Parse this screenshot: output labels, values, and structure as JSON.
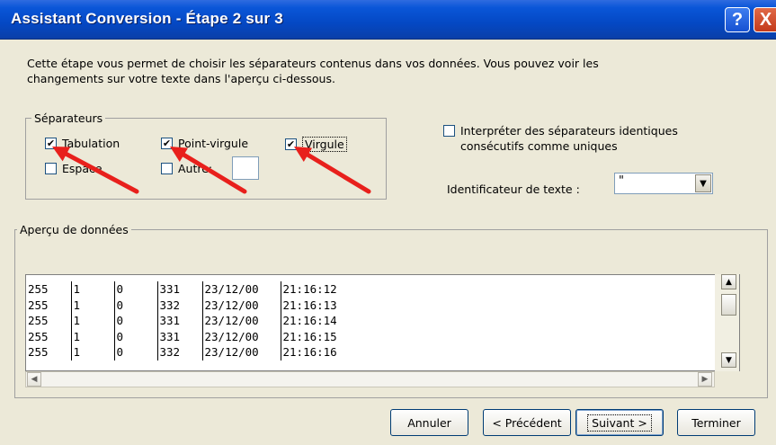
{
  "window": {
    "title": "Assistant Conversion - Étape 2 sur 3",
    "help_label": "?",
    "close_label": "X"
  },
  "description": {
    "line1": "Cette étape vous permet de choisir les séparateurs contenus dans vos données. Vous pouvez voir les",
    "line2": "changements sur votre texte dans l'aperçu ci-dessous."
  },
  "separators": {
    "legend": "Séparateurs",
    "tab": {
      "label": "Tabulation",
      "checked": true
    },
    "semicolon": {
      "label": "Point-virgule",
      "checked": true
    },
    "comma": {
      "label": "Virgule",
      "checked": true
    },
    "space": {
      "label": "Espace",
      "checked": false
    },
    "other": {
      "label": "Autre:",
      "checked": false,
      "value": ""
    }
  },
  "consecutive": {
    "label_line1": "Interpréter des séparateurs identiques",
    "label_line2": "consécutifs comme uniques",
    "checked": false
  },
  "text_qualifier": {
    "label": "Identificateur de texte :",
    "value": "\""
  },
  "preview": {
    "legend": "Aperçu de données",
    "rows": [
      [
        "255",
        "1",
        "0",
        "331",
        "23/12/00",
        "21:16:12"
      ],
      [
        "255",
        "1",
        "0",
        "332",
        "23/12/00",
        "21:16:13"
      ],
      [
        "255",
        "1",
        "0",
        "331",
        "23/12/00",
        "21:16:14"
      ],
      [
        "255",
        "1",
        "0",
        "331",
        "23/12/00",
        "21:16:15"
      ],
      [
        "255",
        "1",
        "0",
        "332",
        "23/12/00",
        "21:16:16"
      ]
    ]
  },
  "buttons": {
    "cancel": "Annuler",
    "previous": "< Précédent",
    "next": "Suivant >",
    "finish": "Terminer"
  },
  "colors": {
    "annotation_arrow": "#e8201c",
    "titlebar": "#0a56d8"
  }
}
